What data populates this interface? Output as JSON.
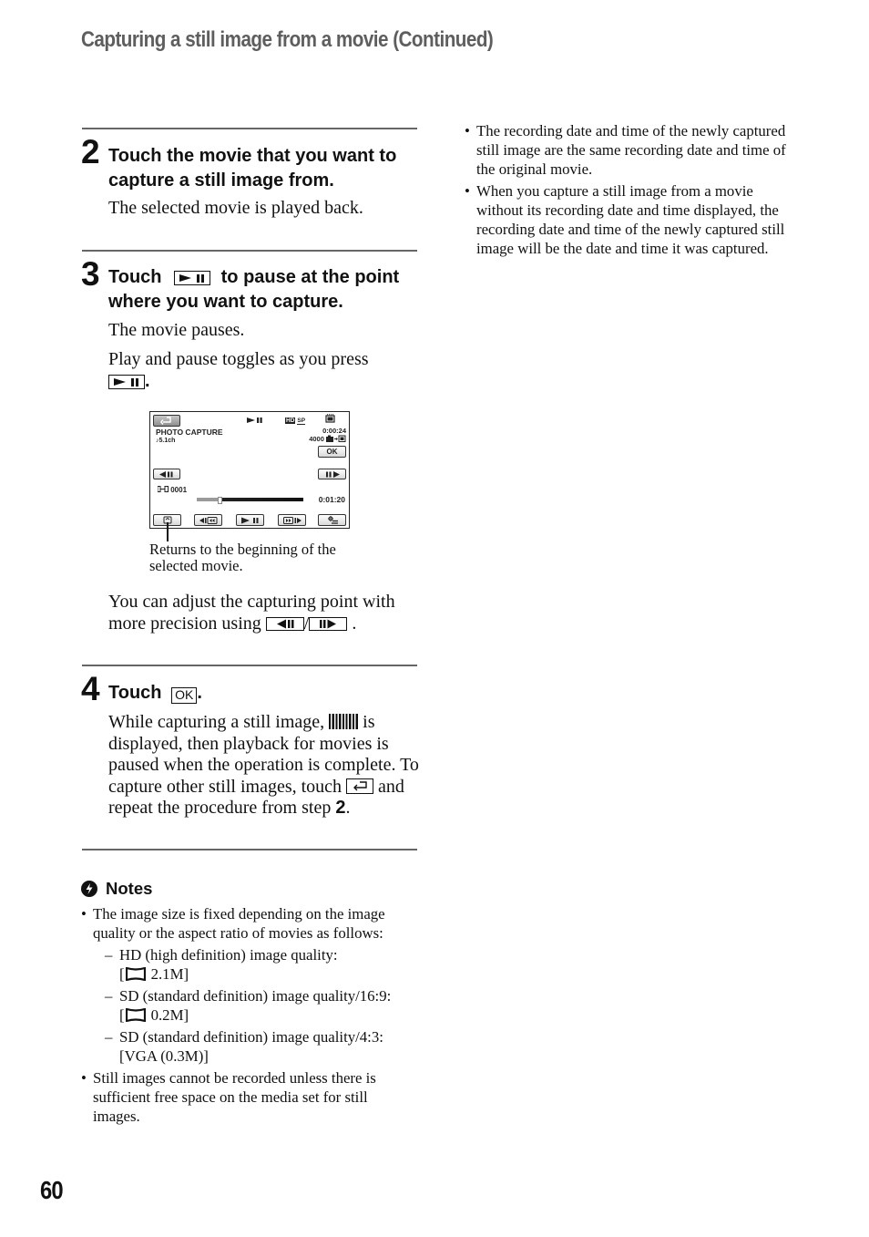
{
  "header": {
    "title": "Capturing a still image from a movie (Continued)"
  },
  "steps": [
    {
      "number": "2",
      "heading": "Touch the movie that you want to capture a still image from.",
      "paragraphs": [
        "The selected movie is played back."
      ]
    },
    {
      "number": "3",
      "heading_before": "Touch",
      "heading_after": "to pause at the point where you want to capture.",
      "paragraphs": [
        "The movie pauses.",
        "Play and pause toggles as you press"
      ],
      "press_suffix": ".",
      "precision_text": "You can adjust the capturing point with more precision using",
      "precision_sep": "/",
      "precision_end": "."
    },
    {
      "number": "4",
      "heading_before": "Touch",
      "ok_key": "OK",
      "heading_after": ".",
      "text_1": "While capturing a still image,",
      "text_2": "is displayed, then playback for movies is paused when the operation is complete. To capture other still images, touch",
      "text_3": "and repeat the procedure from step",
      "step_ref": "2",
      "text_end": "."
    }
  ],
  "lcd": {
    "title": "PHOTO CAPTURE",
    "audio": "♪5.1ch",
    "play_state_icon": "play-pause-icon",
    "quality_badge": "HD",
    "mode_badge": "SP",
    "elapsed": "0:00:24",
    "remaining_photos": "4000",
    "ok_label": "OK",
    "file_number": "0001",
    "duration": "0:01:20",
    "playback_position": 0.2,
    "buttons": [
      "return-icon",
      "frame-back-icon",
      "frame-forward-icon",
      "beginning-icon",
      "prev-icon",
      "play-pause-icon",
      "next-icon",
      "options-icon"
    ]
  },
  "callout": {
    "text": "Returns to the beginning of the selected movie."
  },
  "notes": {
    "heading": "Notes",
    "items": [
      {
        "text": "The image size is fixed depending on the image quality or the aspect ratio of movies as follows:",
        "subitems": [
          {
            "line1": "HD (high definition) image quality:",
            "line2_prefix": "[",
            "size": "2.1M]",
            "icon": "wide-ratio-icon"
          },
          {
            "line1": "SD (standard definition) image quality/16:9:",
            "line2_prefix": "[",
            "size": "0.2M]",
            "icon": "wide-ratio-icon"
          },
          {
            "line1": "SD (standard definition) image quality/4:3:",
            "line2_prefix": "",
            "size": "[VGA (0.3M)]",
            "icon": ""
          }
        ]
      },
      {
        "text": "Still images cannot be recorded unless there is sufficient free space on the media set for still images.",
        "subitems": []
      }
    ]
  },
  "right_column": {
    "bullets": [
      "The recording date and time of the newly captured still image are the same recording date and time of the original movie.",
      "When you capture a still image from a movie without its recording date and time displayed, the recording date and time of the newly captured still image will be the date and time it was captured."
    ]
  },
  "page_number": "60",
  "bullet_char": "•",
  "dash_char": "–"
}
